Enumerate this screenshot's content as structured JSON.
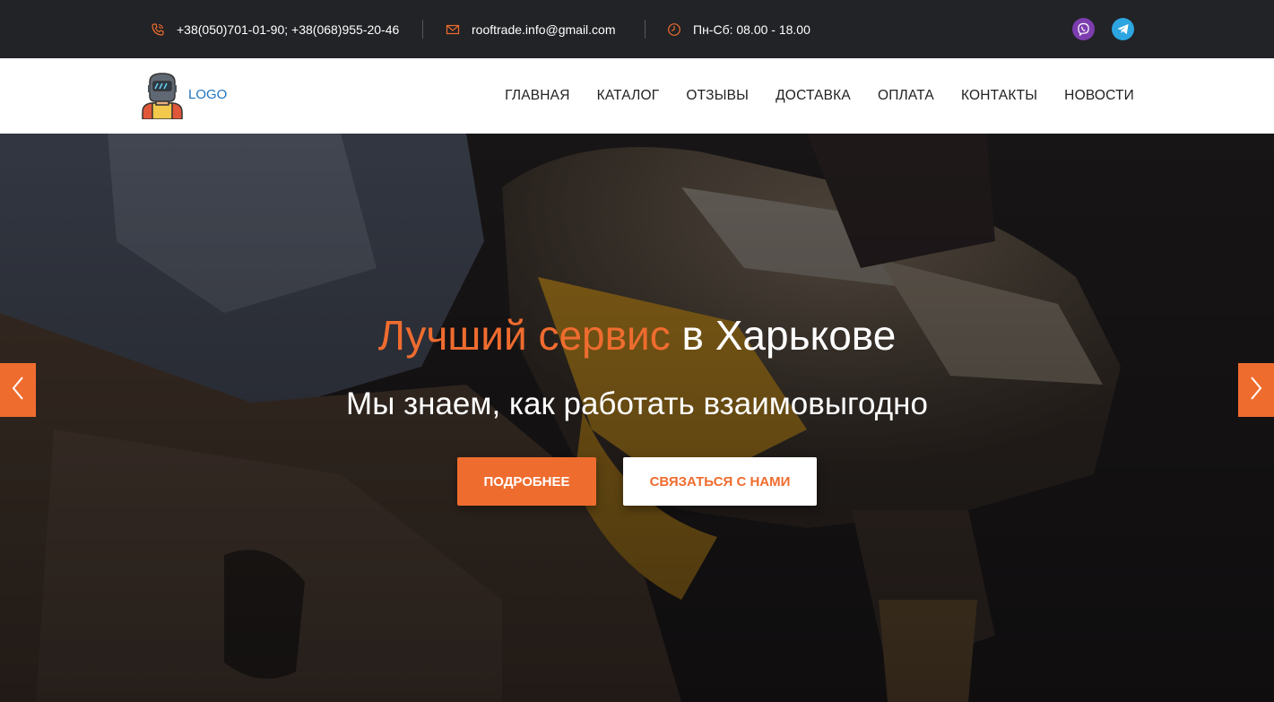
{
  "topbar": {
    "phone": "+38(050)701-01-90; +38(068)955-20-46",
    "email": "rooftrade.info@gmail.com",
    "hours": "Пн-Сб: 08.00 - 18.00",
    "icons": [
      "phone-icon",
      "mail-icon",
      "clock-icon",
      "viber-icon",
      "telegram-icon"
    ]
  },
  "header": {
    "logo_text": "LOGO",
    "menu": [
      {
        "label": "ГЛАВНАЯ"
      },
      {
        "label": "КАТАЛОГ"
      },
      {
        "label": "ОТЗЫВЫ"
      },
      {
        "label": "ДОСТАВКА"
      },
      {
        "label": "ОПЛАТА"
      },
      {
        "label": "КОНТАКТЫ"
      },
      {
        "label": "НОВОСТИ"
      }
    ]
  },
  "hero": {
    "title_accent": "Лучший сервис",
    "title_rest": " в Харькове",
    "subtitle": "Мы знаем, как работать взаимовыгодно",
    "primary_button": "ПОДРОБНЕЕ",
    "secondary_button": "СВЯЗАТЬСЯ С НАМИ"
  },
  "colors": {
    "accent": "#ef6c2f",
    "topbar_bg": "#222326",
    "logo_text": "#1e73be",
    "viber": "#7d3daf",
    "telegram": "#2ca5e0"
  }
}
